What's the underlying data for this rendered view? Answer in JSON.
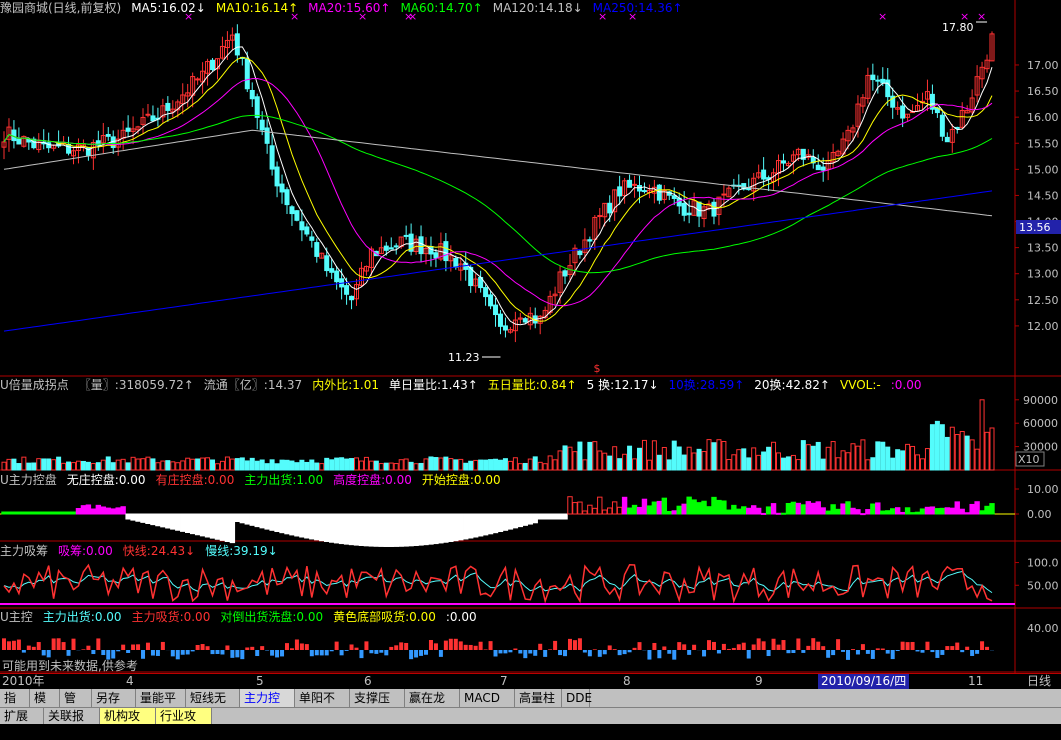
{
  "colors": {
    "up": "#ff3232",
    "down": "#54fcfc",
    "ma5": "#ffffff",
    "ma10": "#ffff00",
    "ma20": "#ff00ff",
    "ma60": "#00ff00",
    "ma120": "#c0c0c0",
    "ma250": "#0000ff",
    "grid": "#b00000"
  },
  "main": {
    "legend": [
      {
        "text": "豫园商城(日线,前复权)",
        "color": "#c0c0c0"
      },
      {
        "text": "MA5:16.02↓",
        "color": "#ffffff"
      },
      {
        "text": "MA10:16.14↑",
        "color": "#ffff00"
      },
      {
        "text": "MA20:15.60↑",
        "color": "#ff00ff"
      },
      {
        "text": "MA60:14.70↑",
        "color": "#00ff00"
      },
      {
        "text": "MA120:14.18↓",
        "color": "#c0c0c0"
      },
      {
        "text": "MA250:14.36↑",
        "color": "#0000ff"
      }
    ],
    "high_label": "17.80",
    "low_label": "11.23",
    "price_tag": "13.56",
    "s_marker": "$"
  },
  "vol": {
    "legend": [
      {
        "text": "U倍量成拐点",
        "color": "#c0c0c0"
      },
      {
        "text": "〖量〗:318059.72↑",
        "color": "#c0c0c0"
      },
      {
        "text": "流通〖亿〗:14.37",
        "color": "#c0c0c0"
      },
      {
        "text": "内外比:1.01",
        "color": "#ffff00"
      },
      {
        "text": "单日量比:1.43↑",
        "color": "#ffffff"
      },
      {
        "text": "五日量比:0.84↑",
        "color": "#ffff00"
      },
      {
        "text": "5 换:12.17↓",
        "color": "#ffffff"
      },
      {
        "text": "10换:28.59↑",
        "color": "#0000ff"
      },
      {
        "text": "20换:42.82↑",
        "color": "#ffffff"
      },
      {
        "text": "VVOL:-",
        "color": "#ffff00"
      },
      {
        "text": ":0.00",
        "color": "#ff00ff"
      }
    ],
    "unit": "X10"
  },
  "ctrl": {
    "legend": [
      {
        "text": "U主力控盘",
        "color": "#c0c0c0"
      },
      {
        "text": "无庄控盘:0.00",
        "color": "#ffffff"
      },
      {
        "text": "有庄控盘:0.00",
        "color": "#ff3232"
      },
      {
        "text": "主力出货:1.00",
        "color": "#00ff00"
      },
      {
        "text": "高度控盘:0.00",
        "color": "#ff00ff"
      },
      {
        "text": "开始控盘:0.00",
        "color": "#ffff00"
      }
    ]
  },
  "absorb": {
    "legend": [
      {
        "text": "主力吸筹",
        "color": "#c0c0c0"
      },
      {
        "text": "吸筹:0.00",
        "color": "#ff00ff"
      },
      {
        "text": "快线:24.43↓",
        "color": "#ff3232"
      },
      {
        "text": "慢线:39.19↓",
        "color": "#54fcfc"
      }
    ]
  },
  "ukong": {
    "legend": [
      {
        "text": "U主控",
        "color": "#c0c0c0"
      },
      {
        "text": "主力出货:0.00",
        "color": "#54fcfc"
      },
      {
        "text": "主力吸货:0.00",
        "color": "#ff3232"
      },
      {
        "text": "对倒出货洗盘:0.00",
        "color": "#00ff00"
      },
      {
        "text": "黄色底部吸货:0.00",
        "color": "#ffff00"
      },
      {
        "text": ":0.00",
        "color": "#ffffff"
      }
    ],
    "note": "可能用到未来数据,供参考"
  },
  "date_axis": {
    "labels": [
      {
        "text": "2010年",
        "x": 2
      },
      {
        "text": "4",
        "x": 126
      },
      {
        "text": "5",
        "x": 256
      },
      {
        "text": "6",
        "x": 364
      },
      {
        "text": "7",
        "x": 500
      },
      {
        "text": "8",
        "x": 623
      },
      {
        "text": "9",
        "x": 755
      },
      {
        "text": "11",
        "x": 968
      }
    ],
    "cursor": "2010/09/16/四",
    "right": "日线"
  },
  "tabs": [
    "指标",
    "模板",
    "管理",
    "另存为",
    "量能平台",
    "短线无敌",
    "主力控盘",
    "单阳不破",
    "支撑压力",
    "赢在龙头",
    "MACD基本",
    "高量柱",
    "DDE"
  ],
  "tabs2": [
    "扩展区",
    "关联报价",
    "机构攻略",
    "行业攻略"
  ],
  "chart_data": [
    {
      "type": "candlestick",
      "title": "豫园商城(日线,前复权)",
      "ylim": [
        11.5,
        17.9
      ],
      "yticks": [
        12.0,
        12.5,
        13.0,
        13.5,
        14.0,
        14.5,
        15.0,
        15.5,
        16.0,
        16.5,
        17.0
      ],
      "annotations": {
        "high": 17.8,
        "low": 11.23,
        "last": 13.56
      },
      "series": [
        {
          "name": "MA5",
          "value": 16.02
        },
        {
          "name": "MA10",
          "value": 16.14
        },
        {
          "name": "MA20",
          "value": 15.6
        },
        {
          "name": "MA60",
          "value": 14.7
        },
        {
          "name": "MA120",
          "value": 14.18
        },
        {
          "name": "MA250",
          "value": 14.36
        }
      ]
    },
    {
      "type": "bar",
      "title": "U倍量成拐点",
      "yticks": [
        30000,
        60000,
        90000
      ],
      "unit": "X10"
    },
    {
      "type": "bar",
      "title": "U主力控盘",
      "yticks": [
        0.0,
        10.0
      ]
    },
    {
      "type": "line",
      "title": "主力吸筹",
      "yticks": [
        50.0,
        100.0
      ],
      "series": [
        {
          "name": "快线",
          "value": 24.43
        },
        {
          "name": "慢线",
          "value": 39.19
        }
      ]
    },
    {
      "type": "bar",
      "title": "U主控",
      "yticks": [
        40.0
      ]
    }
  ]
}
